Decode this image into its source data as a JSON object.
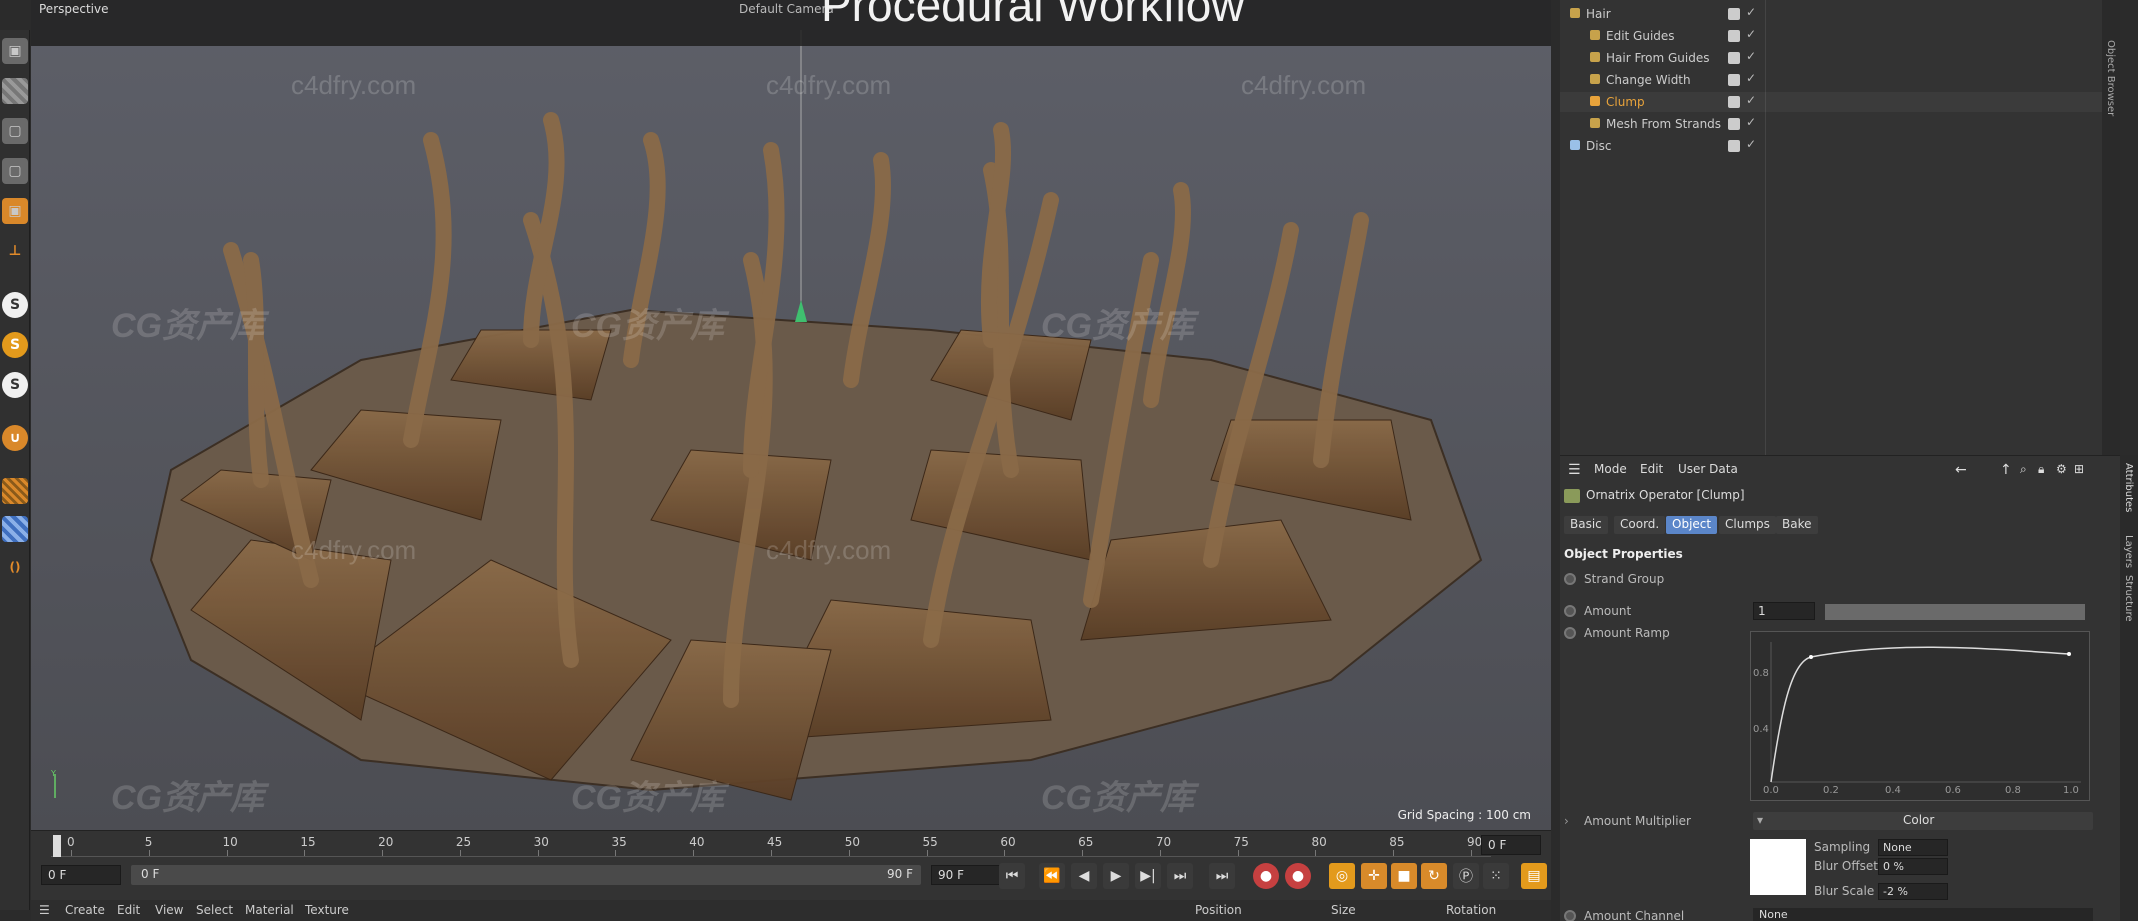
{
  "viewport": {
    "mode_label": "Perspective",
    "camera_label": "Default Camera",
    "overlay_title": "Procedural Workflow",
    "grid_spacing": "Grid Spacing : 100 cm"
  },
  "watermarks": {
    "site": "c4dfry.com",
    "brand": "CG资产库"
  },
  "objects": [
    {
      "name": "Hair",
      "color": "#c7a24b",
      "indent": 0
    },
    {
      "name": "Edit Guides",
      "color": "#c7a24b",
      "indent": 1
    },
    {
      "name": "Hair From Guides",
      "color": "#c7a24b",
      "indent": 1
    },
    {
      "name": "Change Width",
      "color": "#c7a24b",
      "indent": 1
    },
    {
      "name": "Clump",
      "color": "#e8a33b",
      "indent": 1,
      "highlight": true
    },
    {
      "name": "Mesh From Strands",
      "color": "#c7a24b",
      "indent": 1
    },
    {
      "name": "Disc",
      "color": "#9ac0e8",
      "indent": 0
    }
  ],
  "object_browser_label": "Object Browser",
  "attributes": {
    "menu": [
      "Mode",
      "Edit",
      "User Data"
    ],
    "header": "Ornatrix Operator [Clump]",
    "tabs": [
      "Basic",
      "Coord.",
      "Object",
      "Clumps",
      "Bake"
    ],
    "active_tab": "Object",
    "section_title": "Object Properties",
    "strand_group_label": "Strand Group",
    "amount_label": "Amount",
    "amount_value": "1",
    "amount_ramp_label": "Amount Ramp",
    "ramp_ticks_x": [
      "0.0",
      "0.2",
      "0.4",
      "0.6",
      "0.8",
      "1.0"
    ],
    "ramp_ticks_y": [
      "0.8",
      "0.4"
    ],
    "amount_multiplier_label": "Amount Multiplier",
    "color_button": "Color",
    "sampling_label": "Sampling",
    "sampling_value": "None",
    "blur_offset_label": "Blur Offset",
    "blur_offset_value": "0 %",
    "blur_scale_label": "Blur Scale",
    "blur_scale_value": "-2 %",
    "amount_channel_label": "Amount Channel",
    "amount_channel_value": "None"
  },
  "side_tabs": [
    "Attributes",
    "Layers",
    "Structure"
  ],
  "timeline": {
    "ticks": [
      "0",
      "5",
      "10",
      "15",
      "20",
      "25",
      "30",
      "35",
      "40",
      "45",
      "50",
      "55",
      "60",
      "65",
      "70",
      "75",
      "80",
      "85",
      "90"
    ],
    "current_frame": "0 F",
    "start_field": "0 F",
    "range_start": "0 F",
    "range_end": "90 F",
    "end_field": "90 F"
  },
  "bottom_menu": [
    "Create",
    "Edit",
    "View",
    "Select",
    "Material",
    "Texture"
  ],
  "coord_headers": [
    "Position",
    "Size",
    "Rotation"
  ]
}
